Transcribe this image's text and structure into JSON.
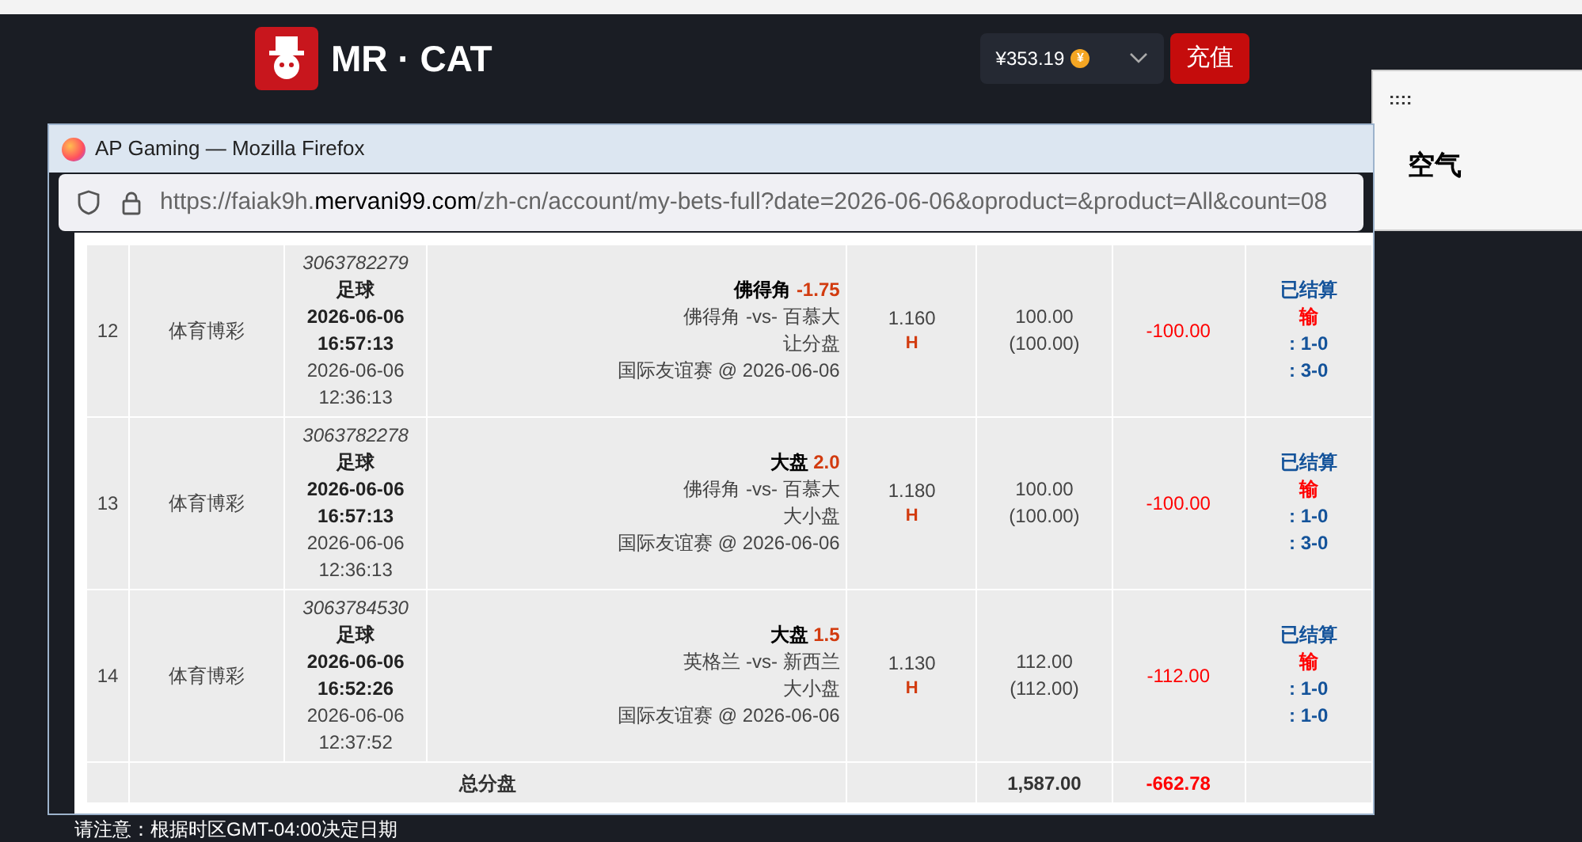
{
  "site_header": {
    "logo_text": "MR · CAT",
    "balance": "¥353.19",
    "coin_symbol": "¥",
    "topup_button": "充值"
  },
  "side_window": {
    "grip": "::::",
    "text": "空气"
  },
  "browser": {
    "title": "AP Gaming — Mozilla Firefox",
    "url_prefix": "https://faiak9h.",
    "url_domain": "mervani99.com",
    "url_path": "/zh-cn/account/my-bets-full?date=2026-06-06&oproduct=&product=All&count=08"
  },
  "bets": [
    {
      "index": "12",
      "product": "体育博彩",
      "bet_id": "3063782279",
      "sport": "足球",
      "event_date": "2026-06-06",
      "event_time": "16:57:13",
      "placed_date": "2026-06-06",
      "placed_time": "12:36:13",
      "selection": "佛得角",
      "line": "-1.75",
      "match": "佛得角 -vs- 百慕大",
      "market": "让分盘",
      "league": "国际友谊赛 @ 2026-06-06",
      "odds": "1.160",
      "odds_type": "H",
      "stake": "100.00",
      "stake_valid": "(100.00)",
      "win_loss": "-100.00",
      "status": "已结算",
      "result": "输",
      "score_1": ": 1-0",
      "score_2": ": 3-0"
    },
    {
      "index": "13",
      "product": "体育博彩",
      "bet_id": "3063782278",
      "sport": "足球",
      "event_date": "2026-06-06",
      "event_time": "16:57:13",
      "placed_date": "2026-06-06",
      "placed_time": "12:36:13",
      "selection": "大盘",
      "line": "2.0",
      "match": "佛得角 -vs- 百慕大",
      "market": "大小盘",
      "league": "国际友谊赛 @ 2026-06-06",
      "odds": "1.180",
      "odds_type": "H",
      "stake": "100.00",
      "stake_valid": "(100.00)",
      "win_loss": "-100.00",
      "status": "已结算",
      "result": "输",
      "score_1": ": 1-0",
      "score_2": ": 3-0"
    },
    {
      "index": "14",
      "product": "体育博彩",
      "bet_id": "3063784530",
      "sport": "足球",
      "event_date": "2026-06-06",
      "event_time": "16:52:26",
      "placed_date": "2026-06-06",
      "placed_time": "12:37:52",
      "selection": "大盘",
      "line": "1.5",
      "match": "英格兰 -vs- 新西兰",
      "market": "大小盘",
      "league": "国际友谊赛 @ 2026-06-06",
      "odds": "1.130",
      "odds_type": "H",
      "stake": "112.00",
      "stake_valid": "(112.00)",
      "win_loss": "-112.00",
      "status": "已结算",
      "result": "输",
      "score_1": ": 1-0",
      "score_2": ": 1-0"
    }
  ],
  "totals": {
    "label": "总分盘",
    "stake": "1,587.00",
    "win_loss": "-662.78"
  },
  "footer_note": "请注意：根据时区GMT-04:00决定日期"
}
